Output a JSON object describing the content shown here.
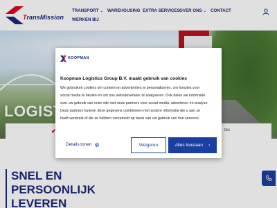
{
  "brand": {
    "logo_prefix": "T",
    "logo_name": "ransMission",
    "colors": {
      "primary": "#1b2a78",
      "accent": "#e3051b",
      "button": "#1b3fa0"
    }
  },
  "nav": {
    "items": [
      {
        "label": "Transport",
        "has_dropdown": true
      },
      {
        "label": "Warehousing",
        "has_dropdown": false
      },
      {
        "label": "Extra services",
        "has_dropdown": false
      },
      {
        "label": "Over ons",
        "has_dropdown": true
      },
      {
        "label": "Contact",
        "has_dropdown": false
      },
      {
        "label": "Werken bij",
        "has_dropdown": false
      }
    ],
    "chevron": "⌄",
    "user_icon": "user-icon"
  },
  "hero": {
    "title": "Logistie"
  },
  "usp": {
    "check": "✔",
    "tail": "tes"
  },
  "main": {
    "title_lines": [
      "Snel en",
      "persoonlijk",
      "leveren"
    ]
  },
  "cookie_modal": {
    "logo_text": "KOOPMAN",
    "title": "Koopman Logistics Group B.V. maakt gebruik van cookies",
    "body_lines": [
      "We gebruiken cookies om content en advertenties te personaliseren, om functies voor",
      "social media te bieden en om ons websiteverkeer te analyseren. Ook delen we informatie",
      "over uw gebruik van onze site met onze partners voor social media, adverteren en analyse.",
      "Deze partners kunnen deze gegevens combineren met andere informatie die u aan ze",
      "heeft verstrekt of die ze hebben verzameld op basis van uw gebruik van hun services."
    ],
    "details_label": "Details tonen",
    "reject_label": "Weigeren",
    "accept_label": "Alles toestaan",
    "accept_arrow": "›"
  }
}
